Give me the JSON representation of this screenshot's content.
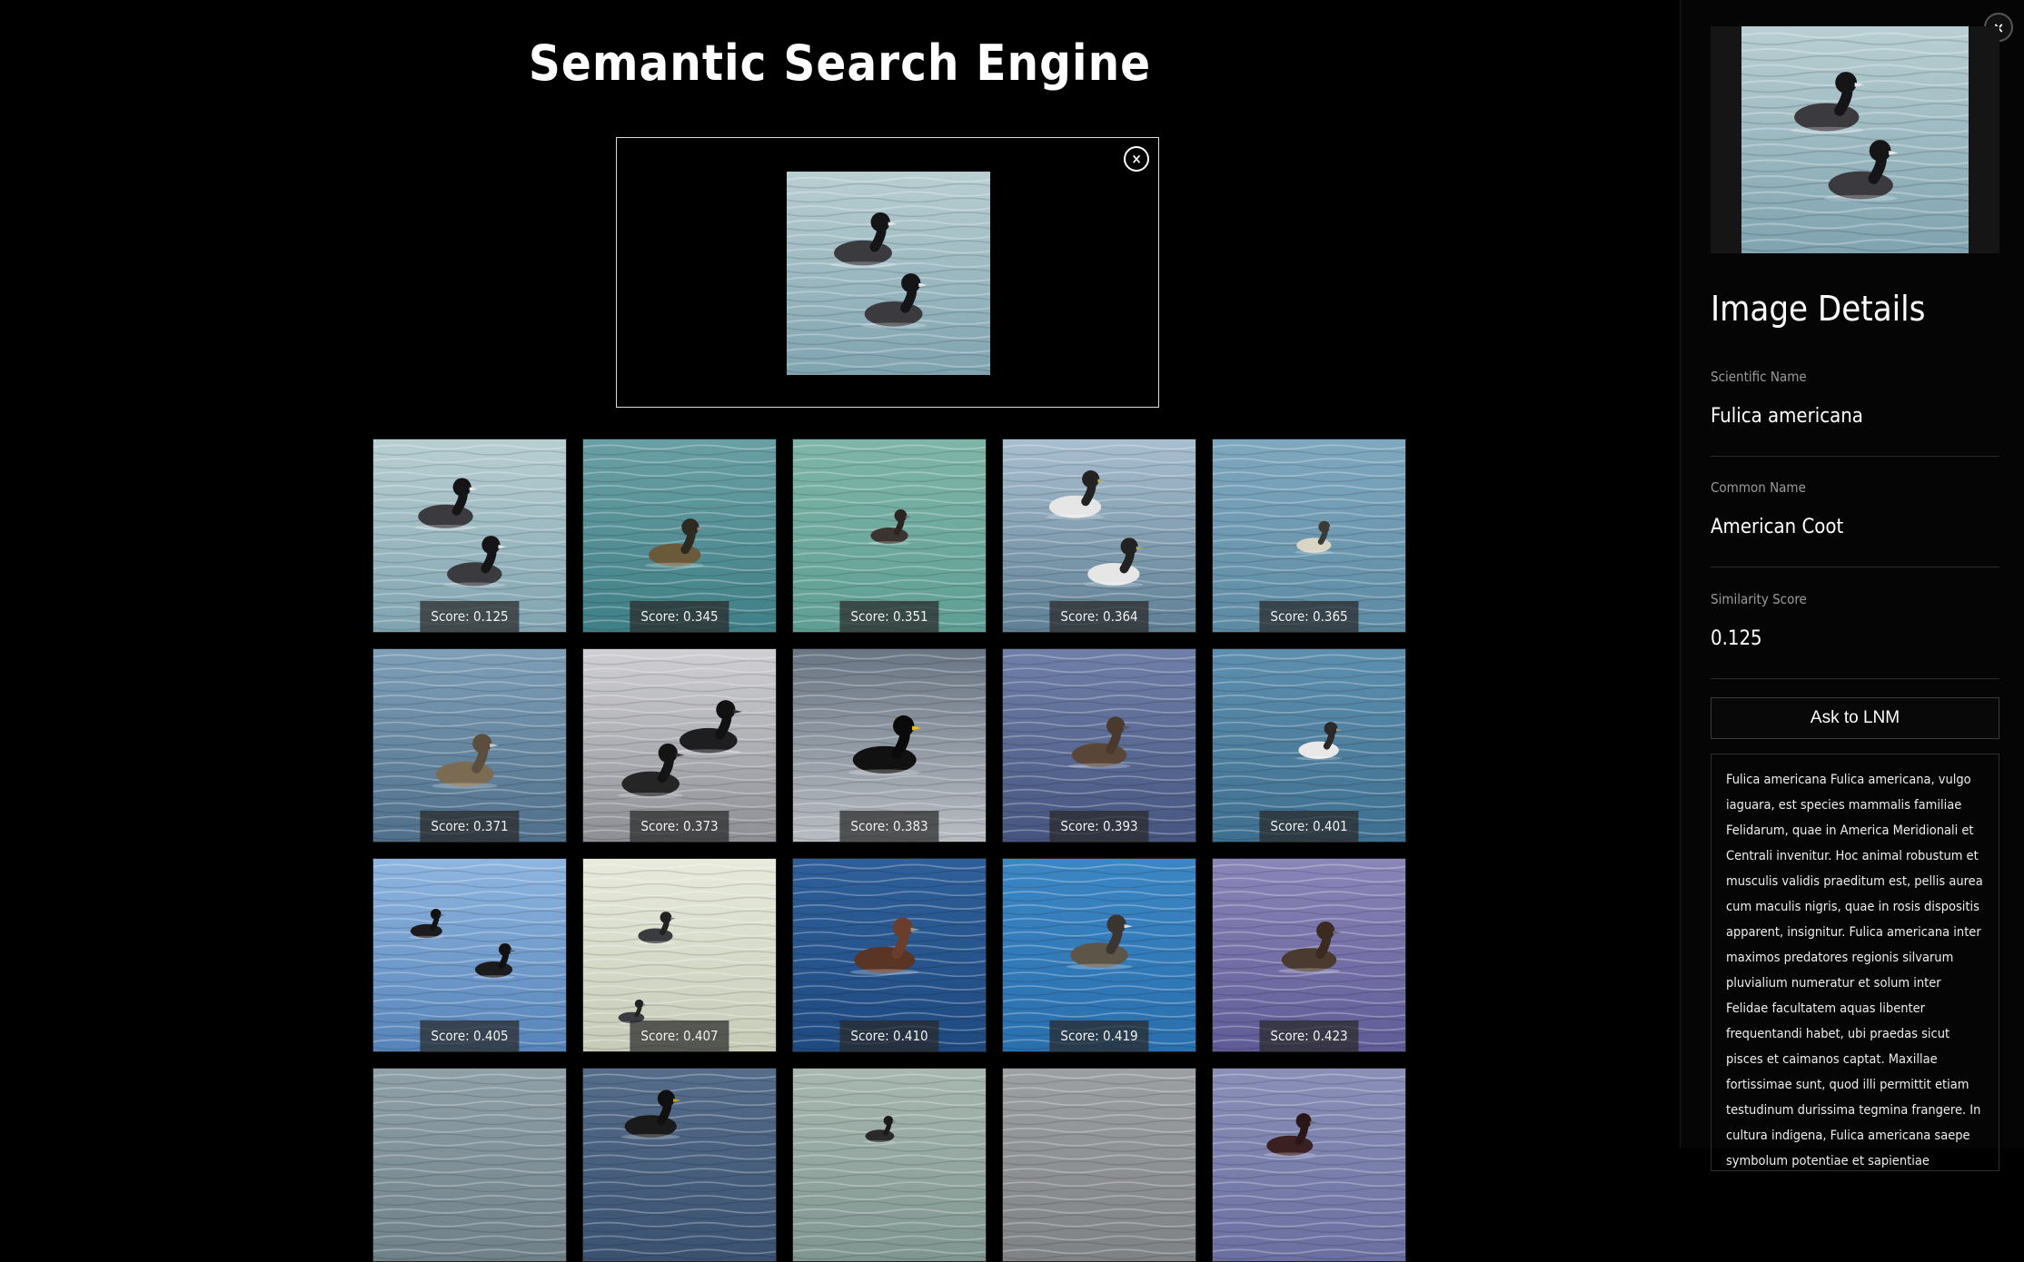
{
  "title": "Semantic Search Engine",
  "upload": {
    "close_icon": "×"
  },
  "results": [
    {
      "score": "Score: 0.125",
      "scene": "coots-two",
      "water": [
        "#b9cfd2",
        "#7fa3b0"
      ]
    },
    {
      "score": "Score: 0.345",
      "scene": "grebe",
      "water": [
        "#6aa0a4",
        "#3f7f86"
      ]
    },
    {
      "score": "Score: 0.351",
      "scene": "duck-small",
      "water": [
        "#7fb5a8",
        "#5f9e93"
      ]
    },
    {
      "score": "Score: 0.364",
      "scene": "grebes-two",
      "water": [
        "#a9bfd0",
        "#5f7f94"
      ]
    },
    {
      "score": "Score: 0.365",
      "scene": "grebe-small",
      "water": [
        "#7fa8bf",
        "#5d8aa3"
      ]
    },
    {
      "score": "Score: 0.371",
      "scene": "grebe-brown",
      "water": [
        "#7f9fb8",
        "#4f6f8a"
      ]
    },
    {
      "score": "Score: 0.373",
      "scene": "grebes-dark",
      "water": [
        "#d0d0d4",
        "#8d8f95"
      ]
    },
    {
      "score": "Score: 0.383",
      "scene": "scoter",
      "water": [
        "#6a7684",
        "#b8bcc2"
      ]
    },
    {
      "score": "Score: 0.393",
      "scene": "duck-brown",
      "water": [
        "#6f7fa8",
        "#46557f"
      ]
    },
    {
      "score": "Score: 0.401",
      "scene": "grebe-white",
      "water": [
        "#5f8fae",
        "#3f6f8f"
      ]
    },
    {
      "score": "Score: 0.405",
      "scene": "ducks-dark",
      "water": [
        "#8fb6e0",
        "#5683b8"
      ]
    },
    {
      "score": "Score: 0.407",
      "scene": "ice-birds",
      "water": [
        "#e8ebdc",
        "#c6cbb8"
      ]
    },
    {
      "score": "Score: 0.410",
      "scene": "redhead",
      "water": [
        "#2f5f99",
        "#1f4a80"
      ]
    },
    {
      "score": "Score: 0.419",
      "scene": "pied-grebe",
      "water": [
        "#3c86c4",
        "#2a6fae"
      ]
    },
    {
      "score": "Score: 0.423",
      "scene": "duck-purple",
      "water": [
        "#8a86b8",
        "#5f5b96"
      ]
    },
    {
      "score": "",
      "scene": "partial",
      "water": [
        "#8fa0a8",
        "#6f8088"
      ]
    },
    {
      "score": "",
      "scene": "partial-dark",
      "water": [
        "#556d8a",
        "#3a5270"
      ]
    },
    {
      "score": "",
      "scene": "partial-small",
      "water": [
        "#a8b8b0",
        "#7f9590"
      ]
    },
    {
      "score": "",
      "scene": "partial-empty",
      "water": [
        "#9da0a3",
        "#7f8285"
      ]
    },
    {
      "score": "",
      "scene": "partial-duck",
      "water": [
        "#8a90b8",
        "#6a6fa0"
      ]
    }
  ],
  "panel": {
    "close_icon": "×",
    "heading": "Image Details",
    "fields": [
      {
        "label": "Scientific Name",
        "value": "Fulica americana"
      },
      {
        "label": "Common Name",
        "value": "American Coot"
      },
      {
        "label": "Similarity Score",
        "value": "0.125"
      }
    ],
    "ask_button": "Ask to LNM",
    "description": "Fulica americana Fulica americana, vulgo iaguara, est species mammalis familiae Felidarum, quae in America Meridionali et Centrali invenitur. Hoc animal robustum et musculis validis praeditum est, pellis aurea cum maculis nigris, quae in rosis dispositis apparent, insignitur. Fulica americana inter maximos predatores regionis silvarum pluvialium numeratur et solum inter Felidae facultatem aquas libenter frequentandi habet, ubi praedas sicut pisces et caimanos captat. Maxillae fortissimae sunt, quod illi permittit etiam testudinum durissima tegmina frangere. In cultura indigena, Fulica americana saepe symbolum potentiae et sapientiae mysticae"
  }
}
